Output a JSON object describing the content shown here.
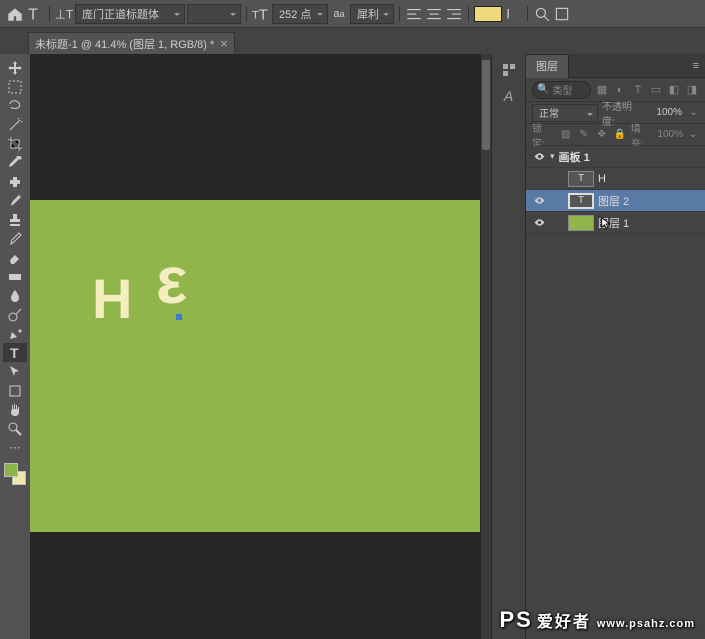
{
  "optbar": {
    "font_family": "庞门正道标题体",
    "font_style": "",
    "size_value": "252 点",
    "aa": "犀利"
  },
  "tab": {
    "title": "未标题-1 @ 41.4% (图层 1, RGB/8) *"
  },
  "canvas": {
    "H": "H",
    "E": "ε"
  },
  "layers_panel": {
    "tab": "图层",
    "search_placeholder": "类型",
    "blend": "正常",
    "opacity_label": "不透明度:",
    "opacity_val": "100%",
    "lock_label": "锁定:",
    "fill_label": "填充:",
    "fill_val": "100%",
    "rows": [
      {
        "name": "画板 1",
        "type": "artboard"
      },
      {
        "name": "H",
        "type": "text"
      },
      {
        "name": "图层 2",
        "type": "text",
        "selected": true
      },
      {
        "name": "图层 1",
        "type": "fill"
      }
    ]
  },
  "watermark": {
    "brand": "PS",
    "sub": "爱好者",
    "url": "www.psahz.com"
  }
}
